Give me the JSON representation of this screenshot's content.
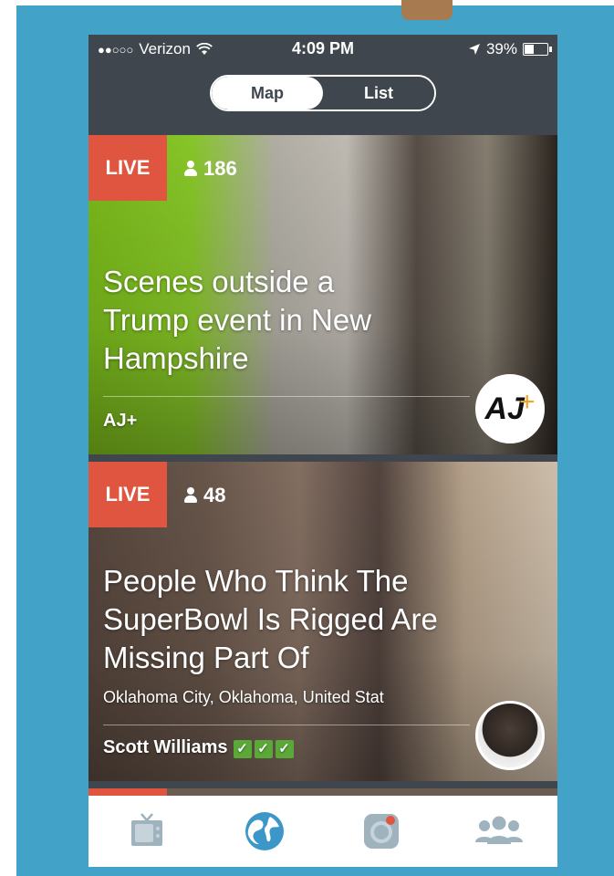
{
  "status_bar": {
    "carrier": "Verizon",
    "time": "4:09 PM",
    "battery": "39%",
    "battery_level": 0.39
  },
  "view_toggle": {
    "map_label": "Map",
    "list_label": "List",
    "selected": "Map"
  },
  "streams": [
    {
      "live_label": "LIVE",
      "viewers": "186",
      "title": "Scenes outside a Trump event in New Hampshire",
      "location": "",
      "author": "AJ+",
      "verified_checks": 0
    },
    {
      "live_label": "LIVE",
      "viewers": "48",
      "title": "People Who Think The SuperBowl Is Rigged Are Missing Part Of",
      "location": "Oklahoma City, Oklahoma, United Stat",
      "author": "Scott Williams",
      "verified_checks": 3,
      "check_glyph": "✓"
    }
  ],
  "bottom_nav": {
    "items": [
      "tv-icon",
      "globe-icon",
      "camera-icon",
      "people-icon"
    ],
    "active": "globe-icon"
  },
  "colors": {
    "frame": "#43a2c8",
    "header": "#3f464d",
    "live_badge": "#e0553f",
    "nav_active": "#3c97c8",
    "nav_inactive": "#9fb3bf"
  }
}
